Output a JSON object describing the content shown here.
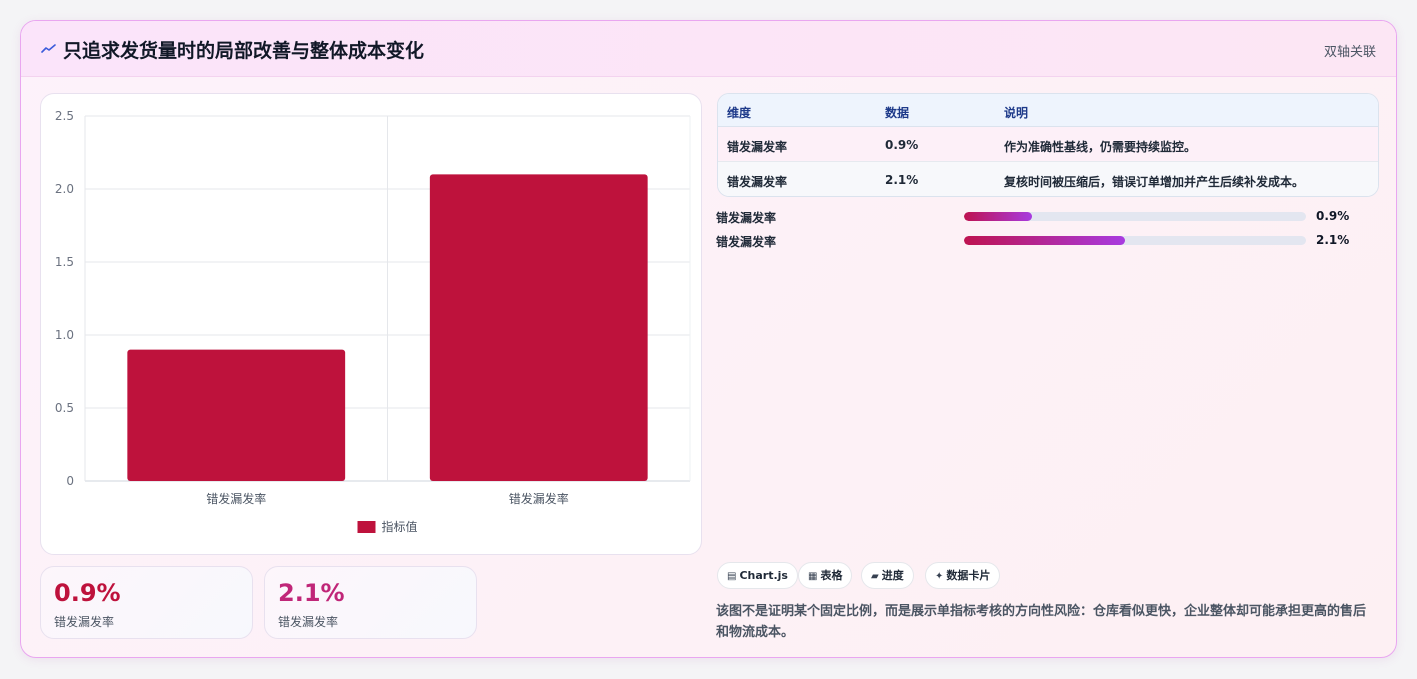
{
  "header": {
    "title": "只追求发货量时的局部改善与整体成本变化",
    "badge": "双轴关联"
  },
  "chart_data": {
    "type": "bar",
    "categories": [
      "错发漏发率",
      "错发漏发率"
    ],
    "series": [
      {
        "name": "指标值",
        "values": [
          0.9,
          2.1
        ],
        "color": "#be123c"
      }
    ],
    "ylim": [
      0,
      2.5
    ],
    "yticks": [
      0,
      0.5,
      1.0,
      1.5,
      2.0,
      2.5
    ],
    "ytick_labels": [
      "0",
      "0.5",
      "1.0",
      "1.5",
      "2.0",
      "2.5"
    ],
    "grid": true,
    "legend": "bottom"
  },
  "stats": [
    {
      "value": "0.9%",
      "label": "错发漏发率",
      "color": "#be123c"
    },
    {
      "value": "2.1%",
      "label": "错发漏发率",
      "color": "#c02678"
    }
  ],
  "table": {
    "headers": [
      "维度",
      "数据",
      "说明"
    ],
    "rows": [
      [
        "错发漏发率",
        "0.9%",
        "作为准确性基线，仍需要持续监控。"
      ],
      [
        "错发漏发率",
        "2.1%",
        "复核时间被压缩后，错误订单增加并产生后续补发成本。"
      ]
    ]
  },
  "progress": [
    {
      "label": "错发漏发率",
      "value": "0.9%",
      "fraction": 0.2
    },
    {
      "label": "错发漏发率",
      "value": "2.1%",
      "fraction": 0.47
    }
  ],
  "chips": [
    {
      "icon": "▤",
      "label": "Chart.js"
    },
    {
      "icon": "▦",
      "label": "表格"
    },
    {
      "icon": "▰",
      "label": "进度"
    },
    {
      "icon": "✦",
      "label": "数据卡片"
    }
  ],
  "note": "该图不是证明某个固定比例，而是展示单指标考核的方向性风险：仓库看似更快，企业整体却可能承担更高的售后和物流成本。"
}
